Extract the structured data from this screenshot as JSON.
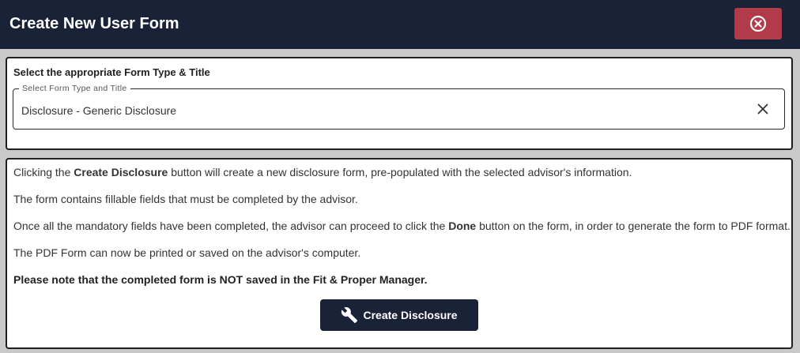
{
  "header": {
    "title": "Create New User Form",
    "close_icon": "close-circle-icon",
    "close_color": "#b23b4a",
    "bg_color": "#1a2238"
  },
  "form_type": {
    "heading": "Select the appropriate Form Type & Title",
    "legend": "Select Form Type and Title",
    "value": "Disclosure - Generic Disclosure",
    "clear_icon": "clear-x-icon"
  },
  "info": {
    "p1_pre": "Clicking the ",
    "p1_bold": "Create Disclosure",
    "p1_post": " button will create a new disclosure form, pre-populated with the selected advisor's information.",
    "p2": "The form contains fillable fields that must be completed by the advisor.",
    "p3_pre": "Once all the mandatory fields have been completed, the advisor can proceed to click the ",
    "p3_bold": "Done",
    "p3_post": " button on the form, in order to generate the form to PDF format.",
    "p4": "The PDF Form can now be printed or saved on the advisor's computer.",
    "p5": "Please note that the completed form is NOT saved in the Fit & Proper Manager."
  },
  "create_button": {
    "label": "Create Disclosure",
    "icon": "wrench-icon"
  }
}
